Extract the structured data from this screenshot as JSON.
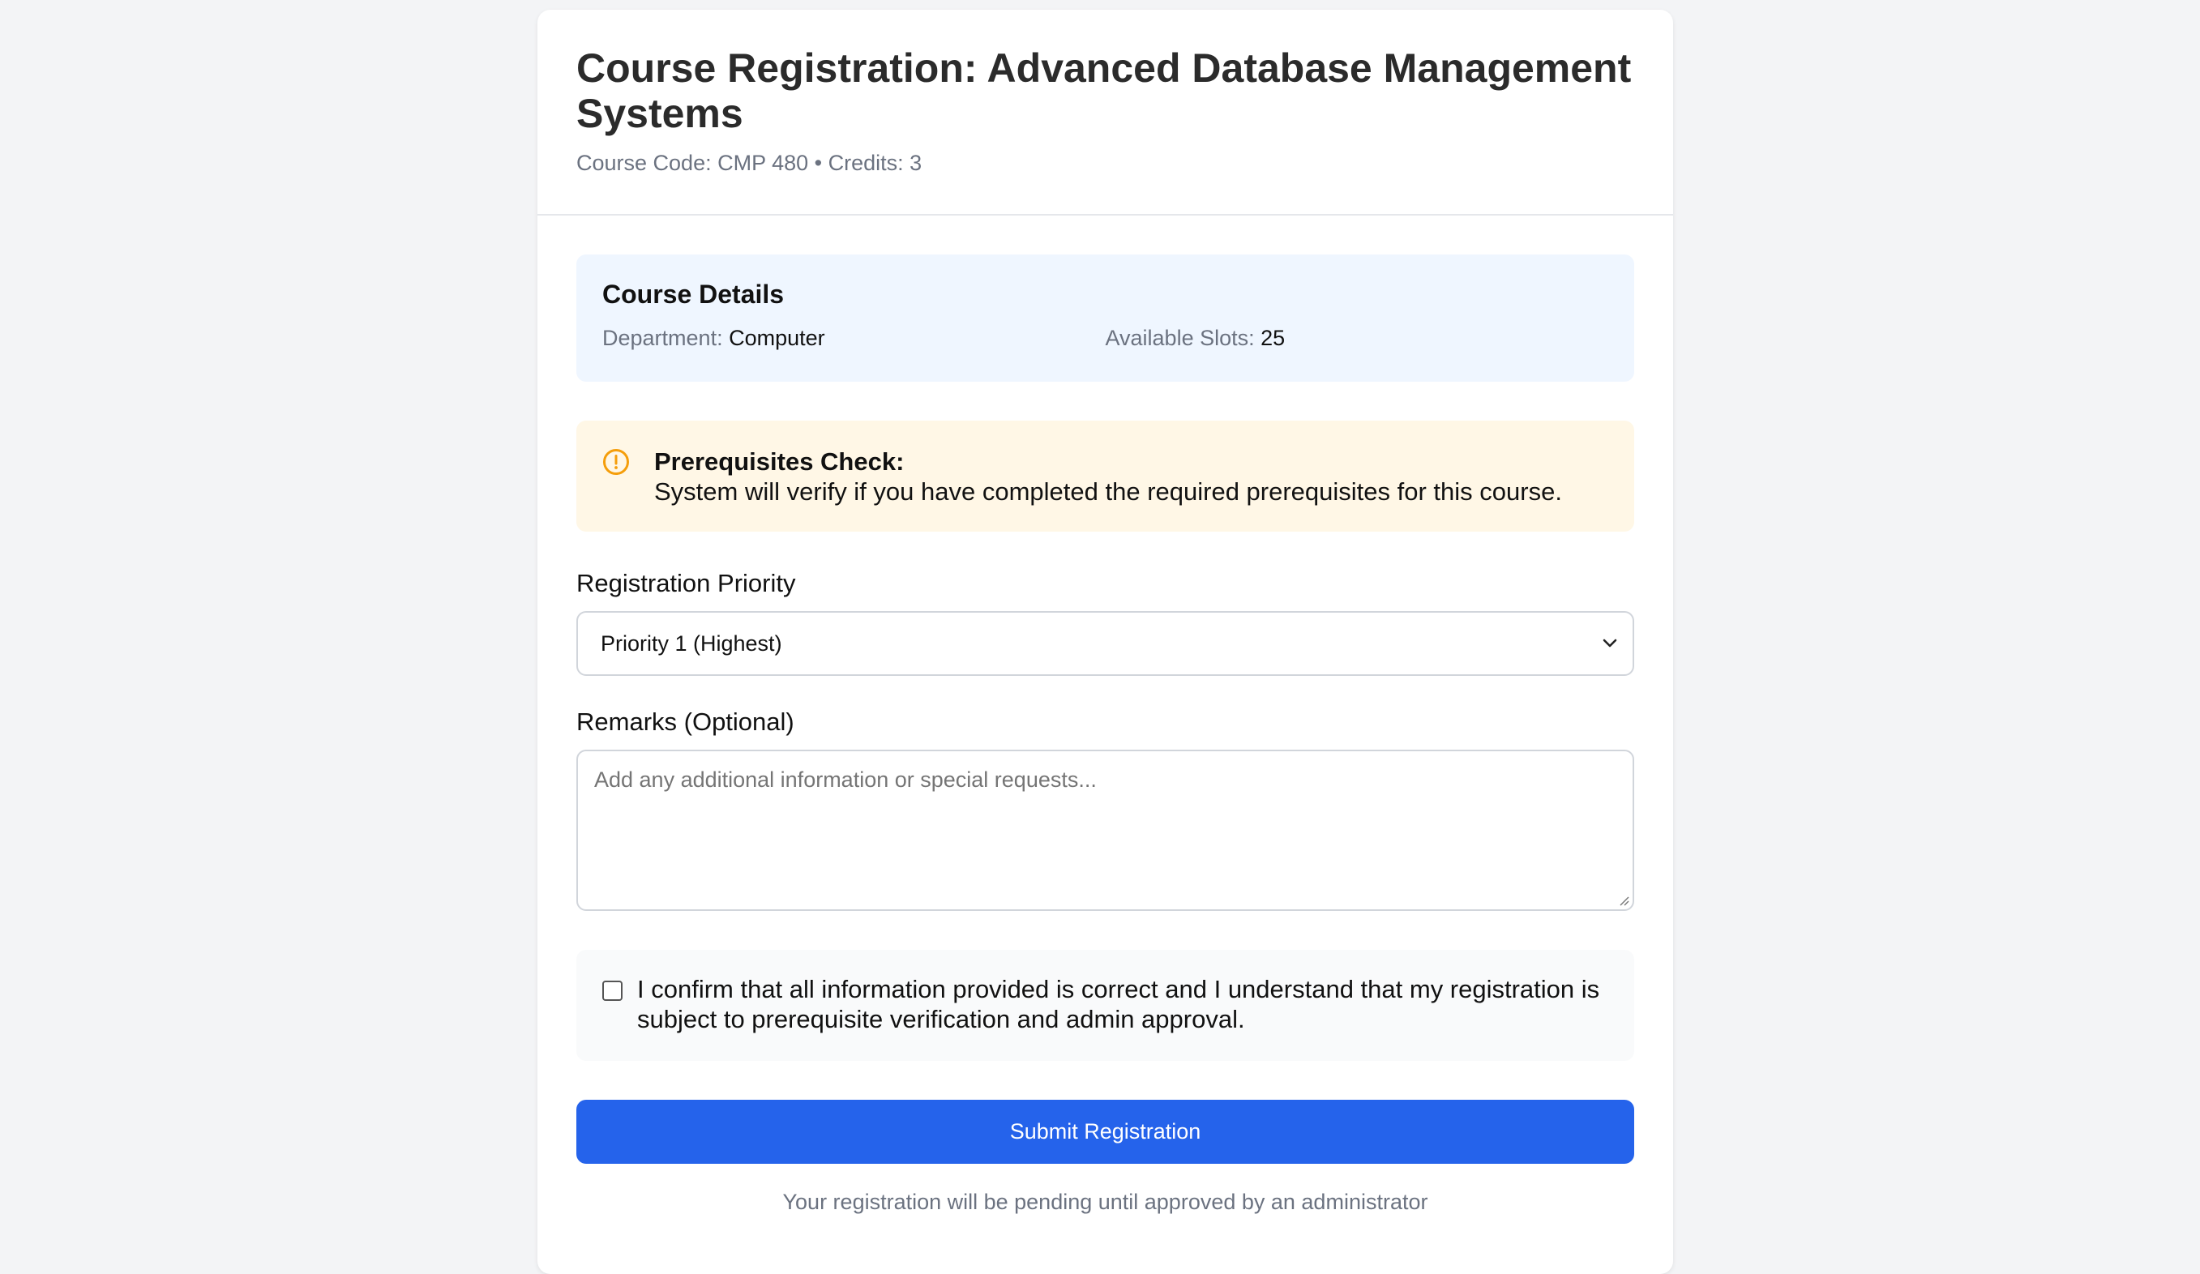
{
  "header": {
    "title": "Course Registration: Advanced Database Management Systems",
    "subtitle": "Course Code: CMP 480 • Credits: 3"
  },
  "details": {
    "title": "Course Details",
    "department_label": "Department:",
    "department_value": "Computer",
    "slots_label": "Available Slots:",
    "slots_value": "25"
  },
  "prerequisites": {
    "icon": "alert-circle-icon",
    "title": "Prerequisites Check:",
    "message": "System will verify if you have completed the required prerequisites for this course."
  },
  "priority": {
    "label": "Registration Priority",
    "selected": "Priority 1 (Highest)"
  },
  "remarks": {
    "label": "Remarks (Optional)",
    "value": "",
    "placeholder": "Add any additional information or special requests..."
  },
  "confirm": {
    "checked": false,
    "text": "I confirm that all information provided is correct and I understand that my registration is subject to prerequisite verification and admin approval."
  },
  "submit": {
    "label": "Submit Registration"
  },
  "footnote": "Your registration will be pending until approved by an administrator",
  "colors": {
    "accent": "#2563eb",
    "details_bg": "#eff6ff",
    "warning_bg": "#fff7e6",
    "warning_icon": "#f59e0b",
    "confirm_bg": "#f9fafb"
  }
}
